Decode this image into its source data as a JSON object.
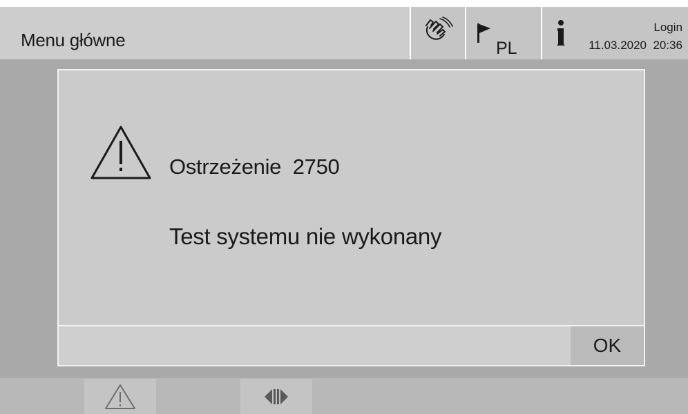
{
  "header": {
    "title": "Menu główne",
    "language": "PL",
    "login_label": "Login",
    "date": "11.03.2020",
    "time": "20:36",
    "datetime": "11.03.2020  20:36"
  },
  "dialog": {
    "warning_title": "Ostrzeżenie  2750",
    "message": "Test systemu nie wykonany",
    "ok_label": "OK"
  },
  "icons": {
    "hand": "hand-pointer-icon",
    "flag": "flag-icon",
    "person": "person-info-icon",
    "warning": "warning-triangle-icon",
    "bottom_warning": "warning-triangle-icon",
    "bottom_toggle": "double-arrow-icon"
  },
  "colors": {
    "background": "#a9a9a9",
    "header": "#cdcdcd",
    "dialog": "#cbcbcb",
    "ok_button": "#bababa"
  }
}
